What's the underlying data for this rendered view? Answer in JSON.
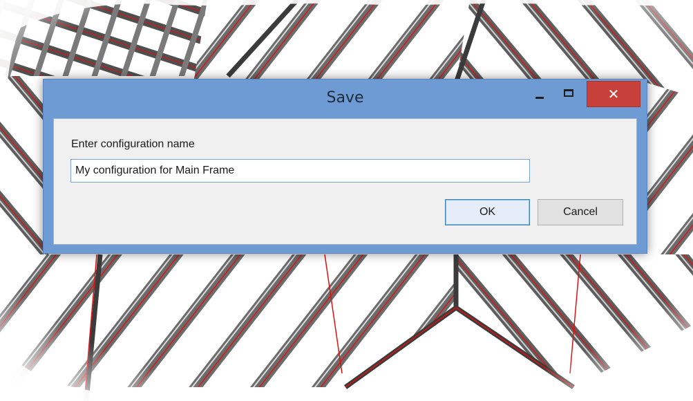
{
  "dialog": {
    "title": "Save",
    "prompt_label": "Enter configuration name",
    "name_input": {
      "value": "My configuration for Main Frame",
      "placeholder": ""
    },
    "ok_label": "OK",
    "cancel_label": "Cancel",
    "close_glyph": "✕"
  },
  "icons": {
    "minimize": "minimize-icon",
    "maximize": "maximize-icon",
    "close": "close-icon"
  },
  "colors": {
    "titlebar": "#6f9bd4",
    "close_button": "#c7403a",
    "client_area": "#f0f0f0",
    "frame_members": "#555555",
    "frame_red_lines": "#e01010"
  }
}
